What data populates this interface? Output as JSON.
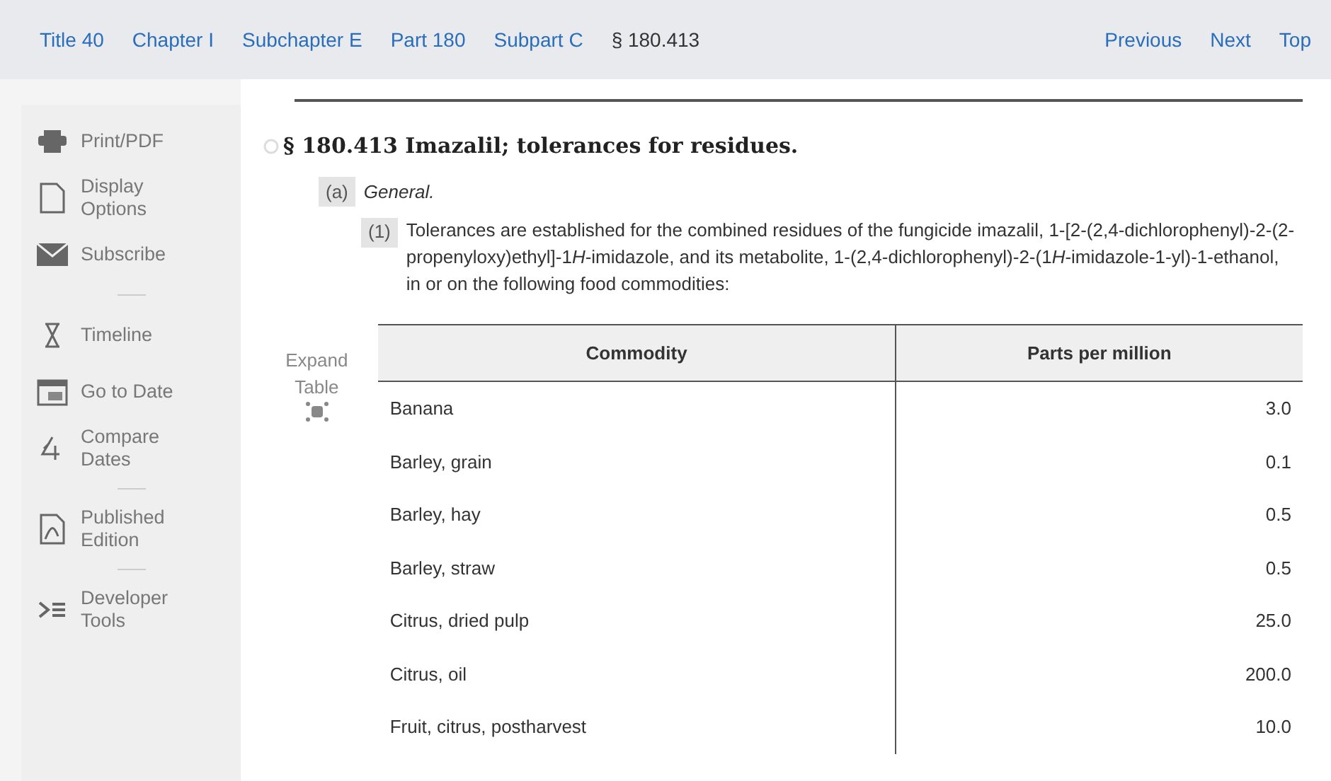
{
  "breadcrumb": [
    {
      "label": "Title 40",
      "kind": "link"
    },
    {
      "label": "Chapter I",
      "kind": "link"
    },
    {
      "label": "Subchapter E",
      "kind": "link"
    },
    {
      "label": "Part 180",
      "kind": "link"
    },
    {
      "label": "Subpart C",
      "kind": "link"
    },
    {
      "label": "§ 180.413",
      "kind": "current"
    }
  ],
  "nav_links": [
    "Previous",
    "Next",
    "Top"
  ],
  "sidebar": [
    {
      "kind": "item",
      "label": "Print/PDF"
    },
    {
      "kind": "item",
      "label": "Display Options"
    },
    {
      "kind": "item",
      "label": "Subscribe"
    },
    {
      "kind": "divider"
    },
    {
      "kind": "item",
      "label": "Timeline"
    },
    {
      "kind": "item",
      "label": "Go to Date"
    },
    {
      "kind": "item",
      "label": "Compare Dates"
    },
    {
      "kind": "divider"
    },
    {
      "kind": "item",
      "label": "Published Edition"
    },
    {
      "kind": "divider"
    },
    {
      "kind": "item",
      "label": "Developer Tools"
    }
  ],
  "section": {
    "heading": "§ 180.413 Imazalil; tolerances for residues.",
    "paragraph_a": {
      "marker": "(a)",
      "text": "General."
    },
    "paragraph_1": {
      "marker": "(1)",
      "segments": [
        {
          "text": "Tolerances are established for the combined residues of the fungicide imazalil, 1-[2-(2,4-dichlorophenyl)-2-(2-propenyloxy)ethyl]-1",
          "italic": false
        },
        {
          "text": "H",
          "italic": true
        },
        {
          "text": "-imidazole, and its metabolite, 1-(2,4-dichlorophenyl)-2-(1",
          "italic": false
        },
        {
          "text": "H",
          "italic": true
        },
        {
          "text": "-imidazole-1-yl)-1-ethanol, in or on the following food commodities:",
          "italic": false
        }
      ]
    }
  },
  "expand_table": "Expand Table",
  "table": {
    "columns": [
      "Commodity",
      "Parts per million"
    ],
    "rows": [
      [
        "Banana",
        "3.0"
      ],
      [
        "Barley, grain",
        "0.1"
      ],
      [
        "Barley, hay",
        "0.5"
      ],
      [
        "Barley, straw",
        "0.5"
      ],
      [
        "Citrus, dried pulp",
        "25.0"
      ],
      [
        "Citrus, oil",
        "200.0"
      ],
      [
        "Fruit, citrus, postharvest",
        "10.0"
      ]
    ]
  }
}
